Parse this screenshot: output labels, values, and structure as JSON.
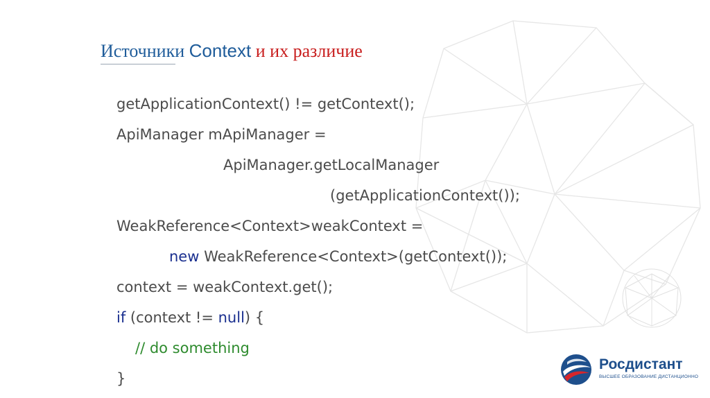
{
  "slide": {
    "title_part1": "Источники ",
    "title_part2": "Context",
    "title_part3": " и их различие"
  },
  "code": {
    "line1": "getApplicationContext() != getContext();",
    "line2": "ApiManager mApiManager =",
    "line3": "ApiManager.getLocalManager",
    "line4": "(getApplicationContext());",
    "line5": "WeakReference<Context>weakContext =",
    "line6_kw": "new",
    "line6_rest": " WeakReference<Context>(getContext());",
    "line7": "context = weakContext.get();",
    "line8_kw1": "if",
    "line8_mid": " (context != ",
    "line8_kw2": "null",
    "line8_end": ") {",
    "line9": "// do something",
    "line10": "}"
  },
  "logo": {
    "name": "Росдистант",
    "subtitle": "ВЫСШЕЕ ОБРАЗОВАНИЕ ДИСТАНЦИОННО"
  },
  "colors": {
    "title_blue": "#1f5c9a",
    "title_red": "#c81e1e",
    "code_text": "#4b4b4b",
    "keyword": "#1a2f8f",
    "comment": "#2e8b2e"
  }
}
